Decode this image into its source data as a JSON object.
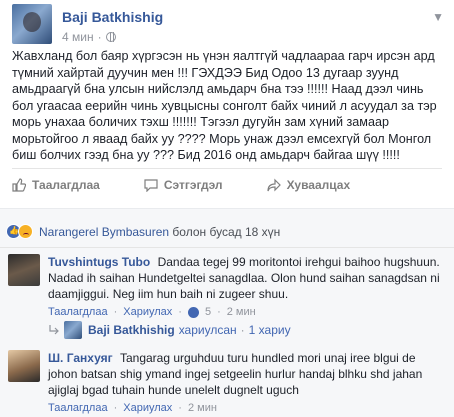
{
  "post": {
    "author": "Baji Batkhishig",
    "time": "4 мин",
    "text": "Жавхланд бол баяр хүргэсэн нь үнэн яалтгүй чадлаараа гарч ирсэн ард түмний хайртай дуучин мен !!! ГЭХДЭЭ Бид Одоо 13 дугаар зуунд амьдраагүй бна улсын нийслэлд амьдарч бна тээ !!!!!! Наад дээл чинь бол угаасаа еерийн чинь хувцысны сонголт байх чиний л асуудал за тэр морь унахаа боличих тэхш !!!!!!! Тэгээл дугуйн зам хүний замаар морьтойгоо л яваад байх уу ???? Морь унаж дээл емсехгүй бол Монгол биш болчих гээд бна уу ??? Бид 2016 онд амьдарч байгаа шүү !!!!!"
  },
  "actions": {
    "like": "Таалагдлаа",
    "comment": "Сэтгэгдэл",
    "share": "Хуваалцах"
  },
  "reactions": {
    "name": "Narangerel Bymbasuren",
    "suffix": " болон бусад 18 хүн"
  },
  "comments": [
    {
      "author": "Tuvshintugs Tubo",
      "text": "Dandaa tegej 99 moritontoi irehgui baihoo hugshuun. Nadad ih saihan Hundetgeltei sanagdlaa. Olon hund saihan sanagdsan ni daamjiggui. Neg iim hun baih ni zugeer shuu.",
      "like": "Таалагдлаа",
      "reply": "Хариулах",
      "likes": "5",
      "time": "2 мин"
    },
    {
      "author": "Ш. Ганхуяг",
      "text": "Tangarag urguhduu turu hundled mori unaj iree blgui de johon batsan shig ymand ingej setgeelin hurlur handaj blhku shd jahan ajiglaj bgad tuhain hunde unelelt dugnelt uguch",
      "like": "Таалагдлаа",
      "reply": "Хариулах",
      "time": "2 мин"
    }
  ],
  "reply_row": {
    "author": "Baji Batkhishig",
    "label": "хариулсан",
    "count": "1 хариу"
  }
}
